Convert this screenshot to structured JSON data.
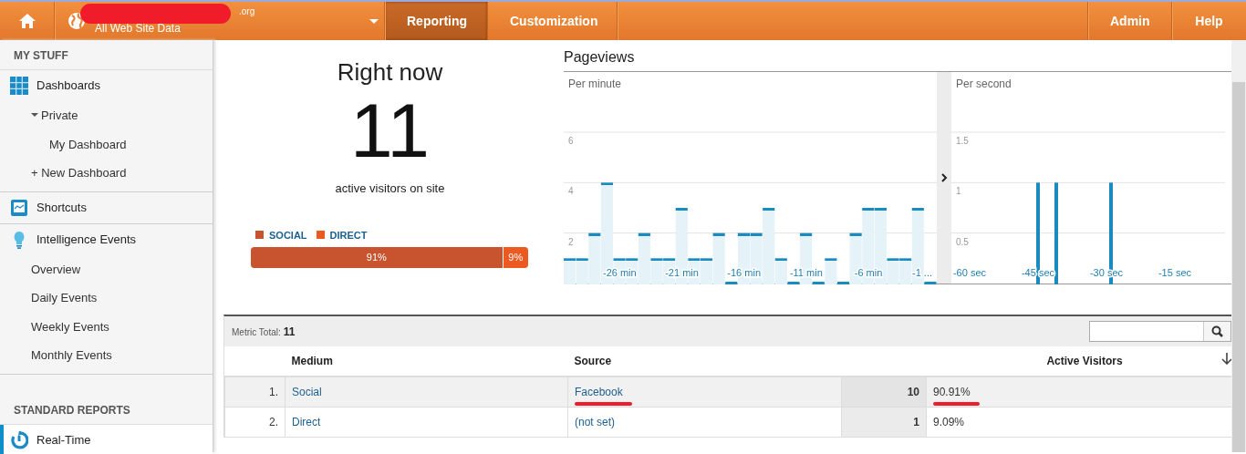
{
  "topbar": {
    "account": ".org",
    "view": "All Web Site Data",
    "tabs": [
      {
        "label": "Reporting",
        "selected": true
      },
      {
        "label": "Customization",
        "selected": false
      }
    ],
    "right_links": [
      {
        "label": "Admin",
        "selected": false
      },
      {
        "label": "Help",
        "selected": false
      }
    ]
  },
  "sidebar": {
    "items": [
      {
        "kind": "heading",
        "label": "MY STUFF"
      },
      {
        "kind": "group",
        "label": "Dashboards",
        "selected": false,
        "children": [
          {
            "label": "Private",
            "expanded": true,
            "children": [
              {
                "label": "My Dashboard"
              }
            ]
          },
          {
            "label": "+ New Dashboard"
          }
        ]
      },
      {
        "kind": "group",
        "label": "Shortcuts",
        "selected": false
      },
      {
        "kind": "group",
        "label": "Intelligence Events",
        "selected": false,
        "children": [
          {
            "label": "Overview"
          },
          {
            "label": "Daily Events"
          },
          {
            "label": "Weekly Events"
          },
          {
            "label": "Monthly Events"
          }
        ]
      },
      {
        "kind": "heading",
        "label": "STANDARD REPORTS"
      },
      {
        "kind": "group",
        "label": "Real-Time",
        "selected": true
      }
    ]
  },
  "right_now": {
    "title": "Right now",
    "count": "11",
    "caption": "active visitors on site",
    "split": [
      {
        "name": "SOCIAL",
        "color": "#c7532f",
        "level": 0.91,
        "label": "91%"
      },
      {
        "name": "DIRECT",
        "color": "#ec5a22",
        "level": 0.09,
        "label": "9%"
      }
    ]
  },
  "pageviews": {
    "title": "Pageviews",
    "charts": [
      {
        "chart_data": {
          "type": "bar",
          "title": "Per minute",
          "x": [
            -30,
            -29,
            -28,
            -27,
            -26,
            -25,
            -24,
            -23,
            -22,
            -21,
            -20,
            -19,
            -18,
            -17,
            -16,
            -15,
            -14,
            -13,
            -12,
            -11,
            -10,
            -9,
            -8,
            -7,
            -6,
            -5,
            -4,
            -3,
            -2,
            -1
          ],
          "values": [
            1,
            1,
            2,
            4,
            1,
            1,
            2,
            1,
            1,
            3,
            1,
            1,
            2,
            0,
            2,
            2,
            3,
            1,
            0,
            2,
            0,
            1,
            0,
            2,
            3,
            3,
            1,
            1,
            3,
            0
          ],
          "xlim": [
            -30.5,
            -0.5
          ],
          "ylim": [
            0,
            6
          ],
          "yticks": [
            2,
            4,
            6
          ],
          "grid": true,
          "xticks": [
            {
              "value": -26,
              "label": "-26 min"
            },
            {
              "value": -21,
              "label": "-21 min"
            },
            {
              "value": -16,
              "label": "-16 min"
            },
            {
              "value": -11,
              "label": "-11 min"
            },
            {
              "value": -6,
              "label": "-6 min"
            },
            {
              "value": -1,
              "label": "-1 ..."
            }
          ]
        }
      },
      {
        "chart_data": {
          "type": "bar",
          "title": "Per second",
          "x": [
            -45,
            -41,
            -29
          ],
          "values": [
            1,
            1,
            1
          ],
          "xlim": [
            -64,
            -4
          ],
          "ylim": [
            0,
            1.5
          ],
          "yticks": [
            0.5,
            1,
            1.5
          ],
          "grid": true,
          "xticks": [
            {
              "value": -60,
              "label": "-60 sec"
            },
            {
              "value": -45,
              "label": "-45 sec"
            },
            {
              "value": -30,
              "label": "-30 sec"
            },
            {
              "value": -15,
              "label": "-15 sec"
            }
          ]
        }
      }
    ]
  },
  "table": {
    "metric_label": "Metric Total:",
    "metric_value": "11",
    "columns": [
      "Medium",
      "Source",
      "Active Visitors"
    ],
    "rows": [
      {
        "index": "1.",
        "medium": "Social",
        "source": "Facebook",
        "count": "10",
        "percent": "90.91%",
        "highlighted": true
      },
      {
        "index": "2.",
        "medium": "Direct",
        "source": "(not set)",
        "count": "1",
        "percent": "9.09%",
        "highlighted": false
      }
    ]
  }
}
